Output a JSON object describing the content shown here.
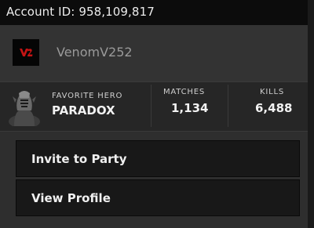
{
  "header": {
    "account_id": "Account ID: 958,109,817"
  },
  "user": {
    "username": "VenomV252",
    "avatar_icon": "venom-emblem-icon",
    "accent_color": "#c41414"
  },
  "stats": {
    "favorite_hero_label": "FAVORITE HERO",
    "favorite_hero_value": "PARADOX",
    "matches_label": "MATCHES",
    "matches_value": "1,134",
    "kills_label": "KILLS",
    "kills_value": "6,488",
    "hero_icon": "hero-portrait-icon"
  },
  "menu": {
    "invite_label": "Invite to Party",
    "view_profile_label": "View Profile"
  }
}
